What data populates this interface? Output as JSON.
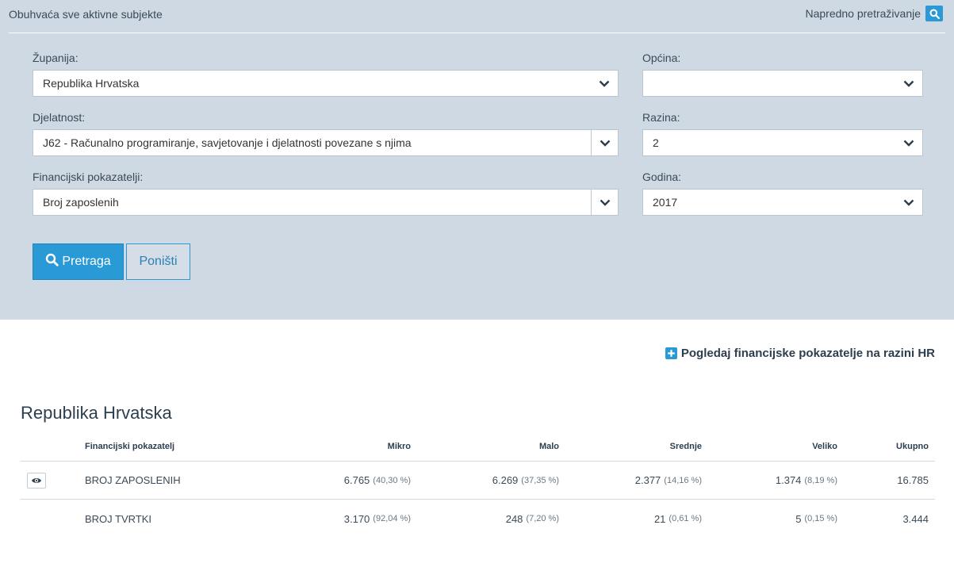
{
  "header": {
    "subtitle": "Obuhvaća sve aktivne subjekte",
    "advanced_search_label": "Napredno pretraživanje"
  },
  "filters": {
    "zupanija": {
      "label": "Županija:",
      "value": "Republika Hrvatska"
    },
    "opcina": {
      "label": "Općina:",
      "value": ""
    },
    "djelatnost": {
      "label": "Djelatnost:",
      "value": "J62 - Računalno programiranje, savjetovanje i djelatnosti povezane s njima"
    },
    "razina": {
      "label": "Razina:",
      "value": "2"
    },
    "financijski_pokazatelji": {
      "label": "Financijski pokazatelji:",
      "value": "Broj zaposlenih"
    },
    "godina": {
      "label": "Godina:",
      "value": "2017"
    }
  },
  "buttons": {
    "search_label": "Pretraga",
    "reset_label": "Poništi"
  },
  "view_hr_label": "Pogledaj financijske pokazatelje na razini HR",
  "results": {
    "title": "Republika Hrvatska",
    "columns": [
      "Financijski pokazatelj",
      "Mikro",
      "Malo",
      "Srednje",
      "Veliko",
      "Ukupno"
    ],
    "rows": [
      {
        "name": "BROJ ZAPOSLENIH",
        "mikro": "6.765",
        "mikro_pct": "(40,30 %)",
        "malo": "6.269",
        "malo_pct": "(37,35 %)",
        "srednje": "2.377",
        "srednje_pct": "(14,16 %)",
        "veliko": "1.374",
        "veliko_pct": "(8,19 %)",
        "ukupno": "16.785"
      },
      {
        "name": "BROJ TVRTKI",
        "mikro": "3.170",
        "mikro_pct": "(92,04 %)",
        "malo": "248",
        "malo_pct": "(7,20 %)",
        "srednje": "21",
        "srednje_pct": "(0,61 %)",
        "veliko": "5",
        "veliko_pct": "(0,15 %)",
        "ukupno": "3.444"
      }
    ]
  },
  "colors": {
    "panel_bg": "#cfd9e3",
    "accent": "#2a9ad6",
    "heading": "#2d3e4e"
  },
  "icons": {
    "advanced_search": "search-icon",
    "search_button": "search-icon",
    "select_arrow": "chevron-down-icon",
    "view_hr": "plus-icon",
    "row_view": "eye-icon"
  }
}
